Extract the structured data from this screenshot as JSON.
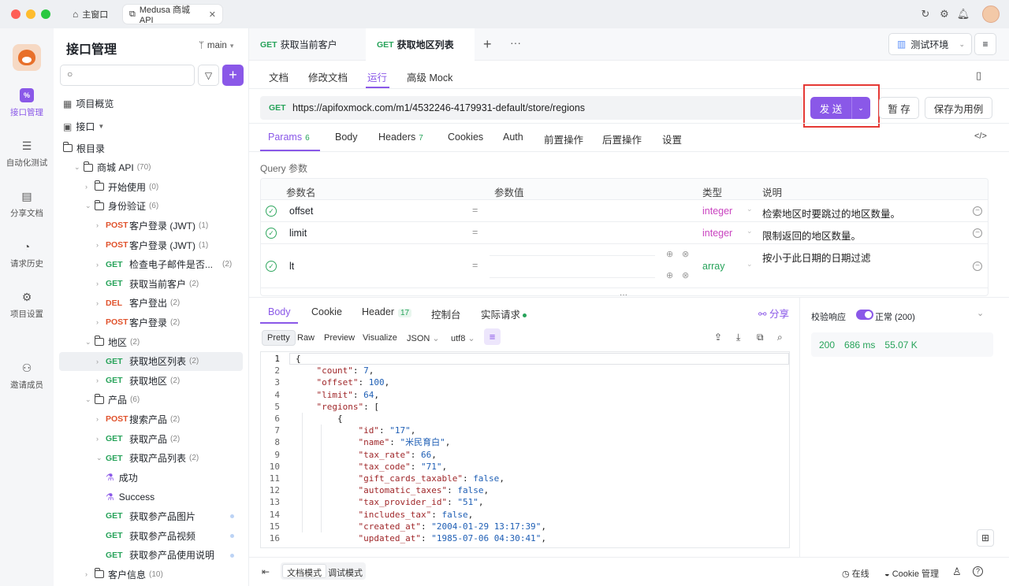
{
  "window": {
    "tabs": [
      {
        "label": "主窗口"
      },
      {
        "label": "Medusa 商城 API"
      }
    ]
  },
  "nav": [
    {
      "label": "接口管理",
      "icon": "api-icon"
    },
    {
      "label": "自动化测试",
      "icon": "automation-icon"
    },
    {
      "label": "分享文档",
      "icon": "share-doc-icon"
    },
    {
      "label": "请求历史",
      "icon": "history-icon"
    },
    {
      "label": "项目设置",
      "icon": "settings-icon"
    },
    {
      "label": "邀请成员",
      "icon": "invite-icon"
    }
  ],
  "sidebar": {
    "title": "接口管理",
    "branch": "main",
    "overview": "项目概览",
    "interfaces": "接口",
    "tree": [
      {
        "depth": 0,
        "type": "folder",
        "label": "根目录",
        "count": ""
      },
      {
        "depth": 1,
        "type": "folder",
        "label": "商城 API",
        "count": "(70)",
        "chev": "open"
      },
      {
        "depth": 2,
        "type": "folder",
        "label": "开始使用",
        "count": "(0)"
      },
      {
        "depth": 2,
        "type": "folder",
        "label": "身份验证",
        "count": "(6)",
        "chev": "open"
      },
      {
        "depth": 3,
        "type": "api",
        "method": "POST",
        "label": "客户登录 (JWT)",
        "count": "(1)"
      },
      {
        "depth": 3,
        "type": "api",
        "method": "POST",
        "label": "客户登录 (JWT)",
        "count": "(1)"
      },
      {
        "depth": 3,
        "type": "api",
        "method": "GET",
        "label": "检查电子邮件是否...",
        "count": "(2)"
      },
      {
        "depth": 3,
        "type": "api",
        "method": "GET",
        "label": "获取当前客户",
        "count": "(2)"
      },
      {
        "depth": 3,
        "type": "api",
        "method": "DEL",
        "label": "客户登出",
        "count": "(2)"
      },
      {
        "depth": 3,
        "type": "api",
        "method": "POST",
        "label": "客户登录",
        "count": "(2)"
      },
      {
        "depth": 2,
        "type": "folder",
        "label": "地区",
        "count": "(2)",
        "chev": "open"
      },
      {
        "depth": 3,
        "type": "api",
        "method": "GET",
        "label": "获取地区列表",
        "count": "(2)",
        "selected": true
      },
      {
        "depth": 3,
        "type": "api",
        "method": "GET",
        "label": "获取地区",
        "count": "(2)"
      },
      {
        "depth": 2,
        "type": "folder",
        "label": "产品",
        "count": "(6)",
        "chev": "open"
      },
      {
        "depth": 3,
        "type": "api",
        "method": "POST",
        "label": "搜索产品",
        "count": "(2)"
      },
      {
        "depth": 3,
        "type": "api",
        "method": "GET",
        "label": "获取产品",
        "count": "(2)"
      },
      {
        "depth": 3,
        "type": "api",
        "method": "GET",
        "label": "获取产品列表",
        "count": "(2)",
        "chev": "open"
      },
      {
        "depth": 4,
        "type": "case",
        "label": "成功",
        "count": ""
      },
      {
        "depth": 4,
        "type": "case",
        "label": "Success",
        "count": ""
      },
      {
        "depth": 3,
        "type": "api",
        "method": "GET",
        "label": "获取参产品图片",
        "count": "",
        "nochev": true
      },
      {
        "depth": 3,
        "type": "api",
        "method": "GET",
        "label": "获取参产品视频",
        "count": "",
        "nochev": true
      },
      {
        "depth": 3,
        "type": "api",
        "method": "GET",
        "label": "获取参产品使用说明",
        "count": "",
        "nochev": true
      },
      {
        "depth": 2,
        "type": "folder",
        "label": "客户信息",
        "count": "(10)"
      }
    ]
  },
  "top_tabs": [
    {
      "method": "GET",
      "label": "获取当前客户"
    },
    {
      "method": "GET",
      "label": "获取地区列表"
    }
  ],
  "env": "测试环境",
  "sub_tabs": [
    "文档",
    "修改文档",
    "运行",
    "高级 Mock"
  ],
  "url": {
    "method": "GET",
    "value": "https://apifoxmock.com/m1/4532246-4179931-default/store/regions"
  },
  "buttons": {
    "send": "发 送",
    "save_temp": "暂 存",
    "save_case": "保存为用例"
  },
  "param_tabs": [
    {
      "label": "Params",
      "badge": "6"
    },
    {
      "label": "Body",
      "badge": ""
    },
    {
      "label": "Headers",
      "badge": "7"
    },
    {
      "label": "Cookies",
      "badge": ""
    },
    {
      "label": "Auth",
      "badge": ""
    },
    {
      "label": "前置操作",
      "badge": ""
    },
    {
      "label": "后置操作",
      "badge": ""
    },
    {
      "label": "设置",
      "badge": ""
    }
  ],
  "query_title": "Query 参数",
  "grid_headers": {
    "name": "参数名",
    "value": "参数值",
    "type": "类型",
    "desc": "说明"
  },
  "params": [
    {
      "name": "offset",
      "type": "integer",
      "desc": "检索地区时要跳过的地区数量。"
    },
    {
      "name": "limit",
      "type": "integer",
      "desc": "限制返回的地区数量。"
    },
    {
      "name": "lt",
      "type": "array",
      "desc": "按小于此日期的日期过滤"
    }
  ],
  "resp_tabs": [
    {
      "label": "Body",
      "badge": ""
    },
    {
      "label": "Cookie",
      "badge": ""
    },
    {
      "label": "Header",
      "badge": "17"
    },
    {
      "label": "控制台",
      "badge": ""
    },
    {
      "label": "实际请求",
      "badge": ""
    }
  ],
  "share": "分享",
  "view_tabs": [
    "Pretty",
    "Raw",
    "Preview",
    "Visualize",
    "JSON",
    "utf8"
  ],
  "code_lines": [
    "{",
    "    \"count\": 7,",
    "    \"offset\": 100,",
    "    \"limit\": 64,",
    "    \"regions\": [",
    "        {",
    "            \"id\": \"17\",",
    "            \"name\": \"米民育白\",",
    "            \"tax_rate\": 66,",
    "            \"tax_code\": \"71\",",
    "            \"gift_cards_taxable\": false,",
    "            \"automatic_taxes\": false,",
    "            \"tax_provider_id\": \"51\",",
    "            \"includes_tax\": false,",
    "            \"created_at\": \"2004-01-29 13:17:39\",",
    "            \"updated_at\": \"1985-07-06 04:30:41\","
  ],
  "validate": {
    "label": "校验响应",
    "status": "正常 (200)"
  },
  "stats": {
    "code": "200",
    "time": "686 ms",
    "size": "55.07 K"
  },
  "bottom": {
    "doc_mode": "文档模式",
    "debug_mode": "调试模式",
    "online": "在线",
    "cookie": "Cookie 管理"
  }
}
